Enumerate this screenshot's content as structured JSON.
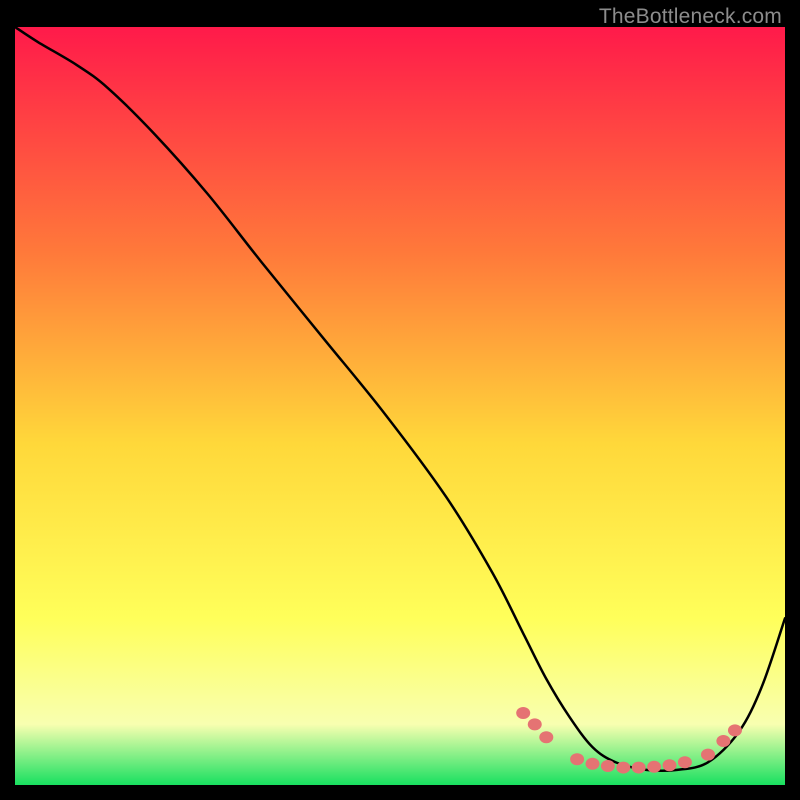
{
  "watermark": "TheBottleneck.com",
  "colors": {
    "gradient_top": "#ff1a4a",
    "gradient_mid1": "#ff7a3a",
    "gradient_mid2": "#ffd83a",
    "gradient_yellow": "#ffff5a",
    "gradient_pale": "#f8ffb0",
    "gradient_green": "#18e060",
    "curve": "#000000",
    "dots": "#e57373"
  },
  "chart_data": {
    "type": "line",
    "title": "",
    "xlabel": "",
    "ylabel": "",
    "xlim": [
      0,
      100
    ],
    "ylim": [
      0,
      100
    ],
    "series": [
      {
        "name": "bottleneck-curve",
        "x": [
          0,
          3,
          8,
          12,
          18,
          25,
          32,
          40,
          48,
          56,
          62,
          66,
          69,
          72,
          75,
          78,
          82,
          86,
          90,
          94,
          97,
          100
        ],
        "y": [
          100,
          98,
          95,
          92,
          86,
          78,
          69,
          59,
          49,
          38,
          28,
          20,
          14,
          9,
          5,
          3,
          2,
          2,
          3,
          7,
          13,
          22
        ]
      }
    ],
    "dot_cluster": {
      "name": "optimal-range-dots",
      "points": [
        {
          "x": 66,
          "y": 9.5
        },
        {
          "x": 67.5,
          "y": 8
        },
        {
          "x": 69,
          "y": 6.3
        },
        {
          "x": 73,
          "y": 3.4
        },
        {
          "x": 75,
          "y": 2.8
        },
        {
          "x": 77,
          "y": 2.5
        },
        {
          "x": 79,
          "y": 2.3
        },
        {
          "x": 81,
          "y": 2.3
        },
        {
          "x": 83,
          "y": 2.4
        },
        {
          "x": 85,
          "y": 2.6
        },
        {
          "x": 87,
          "y": 3.0
        },
        {
          "x": 90,
          "y": 4.0
        },
        {
          "x": 92,
          "y": 5.8
        },
        {
          "x": 93.5,
          "y": 7.2
        }
      ]
    }
  }
}
